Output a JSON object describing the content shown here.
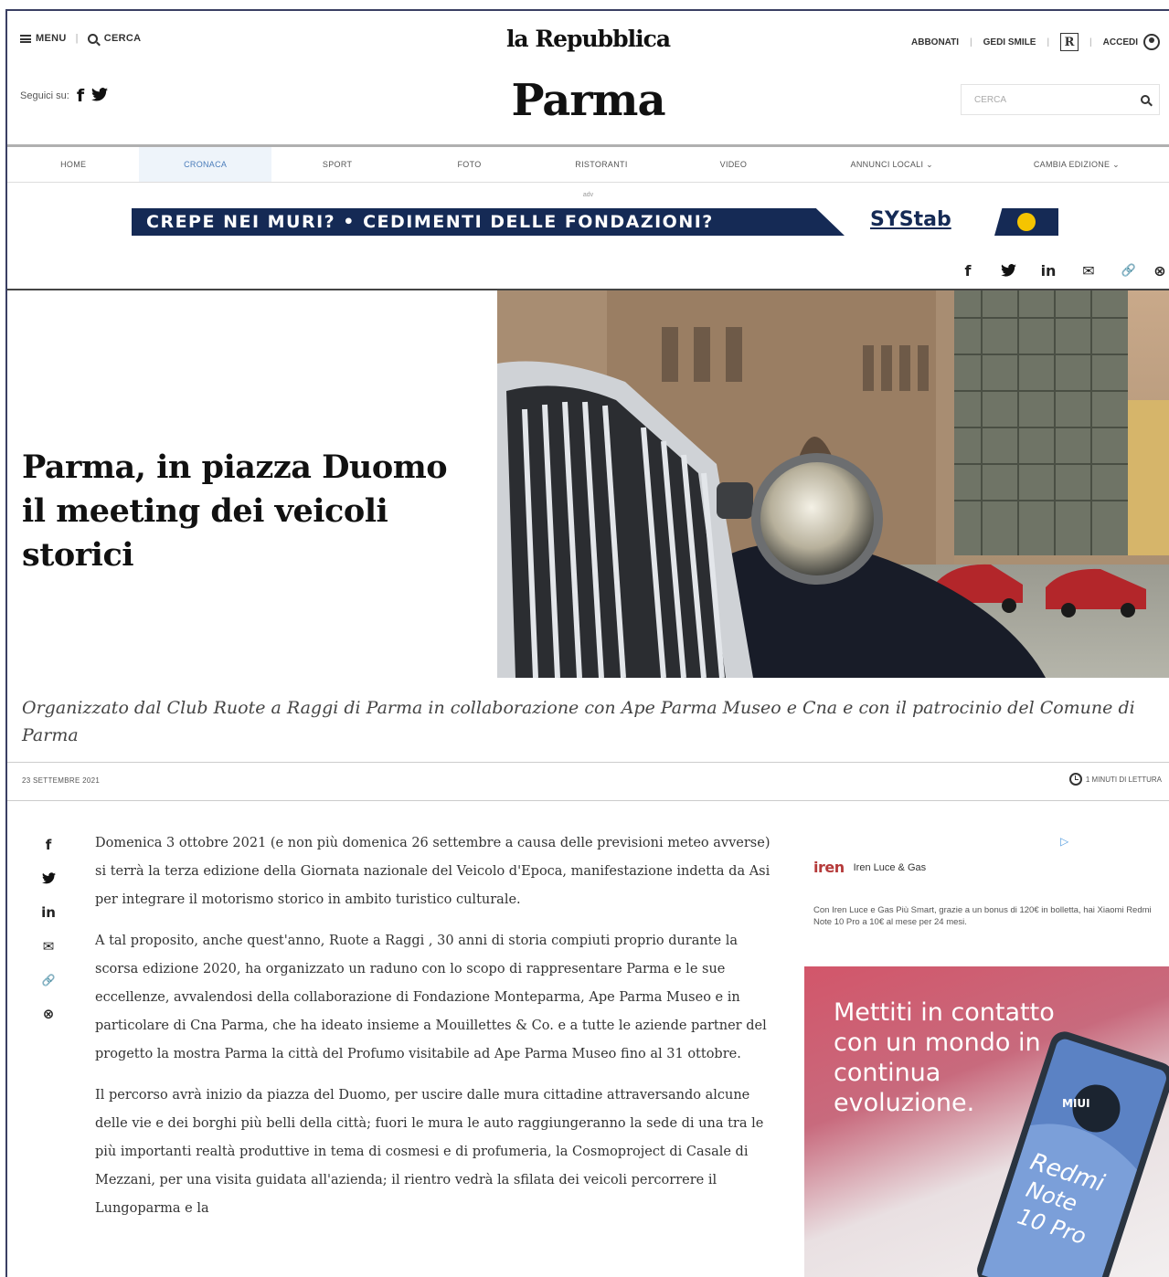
{
  "topbar": {
    "menu_label": "MENU",
    "search_label": "CERCA",
    "brand": "la Repubblica",
    "subscribe_label": "ABBONATI",
    "gedi_label": "GEDI SMILE",
    "r_label": "R",
    "login_label": "ACCEDI"
  },
  "social": {
    "follow_label": "Seguici su:",
    "facebook": "f",
    "twitter": "🐦"
  },
  "edition": {
    "city": "Parma",
    "search_placeholder": "CERCA"
  },
  "nav": {
    "items": [
      {
        "label": "HOME"
      },
      {
        "label": "CRONACA"
      },
      {
        "label": "SPORT"
      },
      {
        "label": "FOTO"
      },
      {
        "label": "RISTORANTI"
      },
      {
        "label": "VIDEO"
      },
      {
        "label": "ANNUNCI LOCALI ⌄"
      },
      {
        "label": "CAMBIA EDIZIONE ⌄"
      }
    ],
    "active_index": 1
  },
  "banner": {
    "label": "adv",
    "text": "CREPE NEI MURI? • CEDIMENTI DELLE FONDAZIONI?",
    "brand": "SYStab"
  },
  "share": {
    "facebook": "f",
    "twitter": "🐦",
    "linkedin": "in",
    "email": "✉",
    "link": "🔗",
    "pinterest": "⊗"
  },
  "article": {
    "title": "Parma, in piazza Duomo il meeting dei veicoli storici",
    "subtitle": "Organizzato dal Club Ruote a Raggi di Parma in collaborazione con Ape Parma Museo e Cna e con il patrocinio del Comune di Parma",
    "date": "23 SETTEMBRE 2021",
    "reading_time": "1 MINUTI DI LETTURA",
    "paragraphs": [
      "Domenica 3 ottobre 2021 (e non più domenica 26 settembre a causa delle previsioni meteo avverse) si terrà la terza edizione della Giornata nazionale del Veicolo d'Epoca, manifestazione indetta da Asi per integrare il motorismo storico in ambito turistico culturale.",
      "A tal proposito, anche quest'anno, Ruote a Raggi , 30 anni di storia compiuti proprio durante la scorsa edizione 2020, ha organizzato un raduno con lo scopo di rappresentare Parma e le sue eccellenze, avvalendosi della collaborazione di Fondazione Monteparma, Ape Parma Museo e in particolare di Cna Parma, che ha ideato insieme a Mouillettes & Co. e a tutte le aziende partner del progetto la mostra Parma la città del Profumo visitabile ad Ape Parma Museo fino al 31 ottobre.",
      "Il percorso avrà inizio da piazza del Duomo, per uscire dalle mura cittadine attraversando alcune delle vie e dei borghi più belli della città; fuori le mura le auto raggiungeranno la sede di una tra le più importanti realtà produttive in tema di cosmesi e di profumeria, la Cosmoproject di Casale di Mezzani, per una visita guidata all'azienda; il rientro vedrà la sfilata dei veicoli percorrere il Lungoparma e la"
    ]
  },
  "side_adv": {
    "advertiser_logo": "iren",
    "advertiser": "Iren Luce & Gas",
    "text": "Con Iren Luce e Gas Più Smart, grazie a un bonus di 120€ in bolletta, hai Xiaomi Redmi Note 10 Pro a 10€ al mese per 24 mesi.",
    "headline": "Mettiti in contatto con un mondo in continua evoluzione.",
    "product_lines": [
      "Redmi",
      "Note",
      "10 Pro"
    ],
    "miui_label": "MIUI",
    "colors": {
      "accent": "#d2566a",
      "brand": "#b53a3a"
    }
  },
  "colors": {
    "banner_bg": "#152a55",
    "nav_active": "#4a7cba",
    "accent_yellow": "#f5c400"
  }
}
